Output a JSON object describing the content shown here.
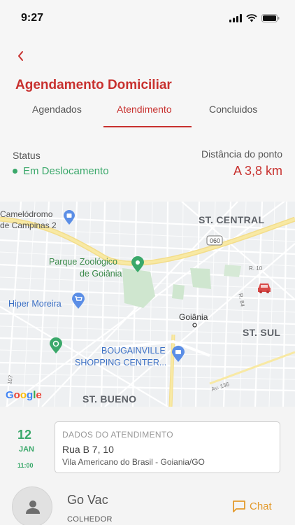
{
  "status_bar": {
    "time": "9:27"
  },
  "header": {
    "title": "Agendamento Domiciliar"
  },
  "tabs": [
    {
      "label": "Agendados"
    },
    {
      "label": "Atendimento"
    },
    {
      "label": "Concluidos"
    }
  ],
  "status": {
    "label": "Status",
    "value": "Em Deslocamento",
    "distance_label": "Distância do ponto",
    "distance_value": "A 3,8 km"
  },
  "map": {
    "labels": {
      "camelodromo_line1": "Camelódromo",
      "camelodromo_line2": "de Campinas 2",
      "st_central": "ST. CENTRAL",
      "route": "060",
      "zoo_line1": "Parque Zoológico",
      "zoo_line2": "de Goiânia",
      "hiper": "Hiper Moreira",
      "goiania": "Goiânia",
      "st_sul": "ST. SUL",
      "bougainville_line1": "BOUGAINVILLE",
      "bougainville_line2": "SHOPPING CENTER...",
      "st_bueno": "ST. BUENO",
      "r10": "R. 10",
      "r84": "R. 84",
      "av136": "Av. 136",
      "r107": "107",
      "google": "Google"
    }
  },
  "appointment": {
    "day": "12",
    "month": "JAN",
    "time": "11:00",
    "heading": "DADOS DO ATENDIMENTO",
    "address": "Rua B 7, 10",
    "city": "Vila Americano do Brasil - Goiania/GO"
  },
  "person": {
    "name": "Go Vac",
    "role": "COLHEDOR",
    "chat_label": "Chat"
  },
  "colors": {
    "primary_red": "#c8312f",
    "status_green": "#3aa86a",
    "chat_orange": "#e39a2c"
  }
}
